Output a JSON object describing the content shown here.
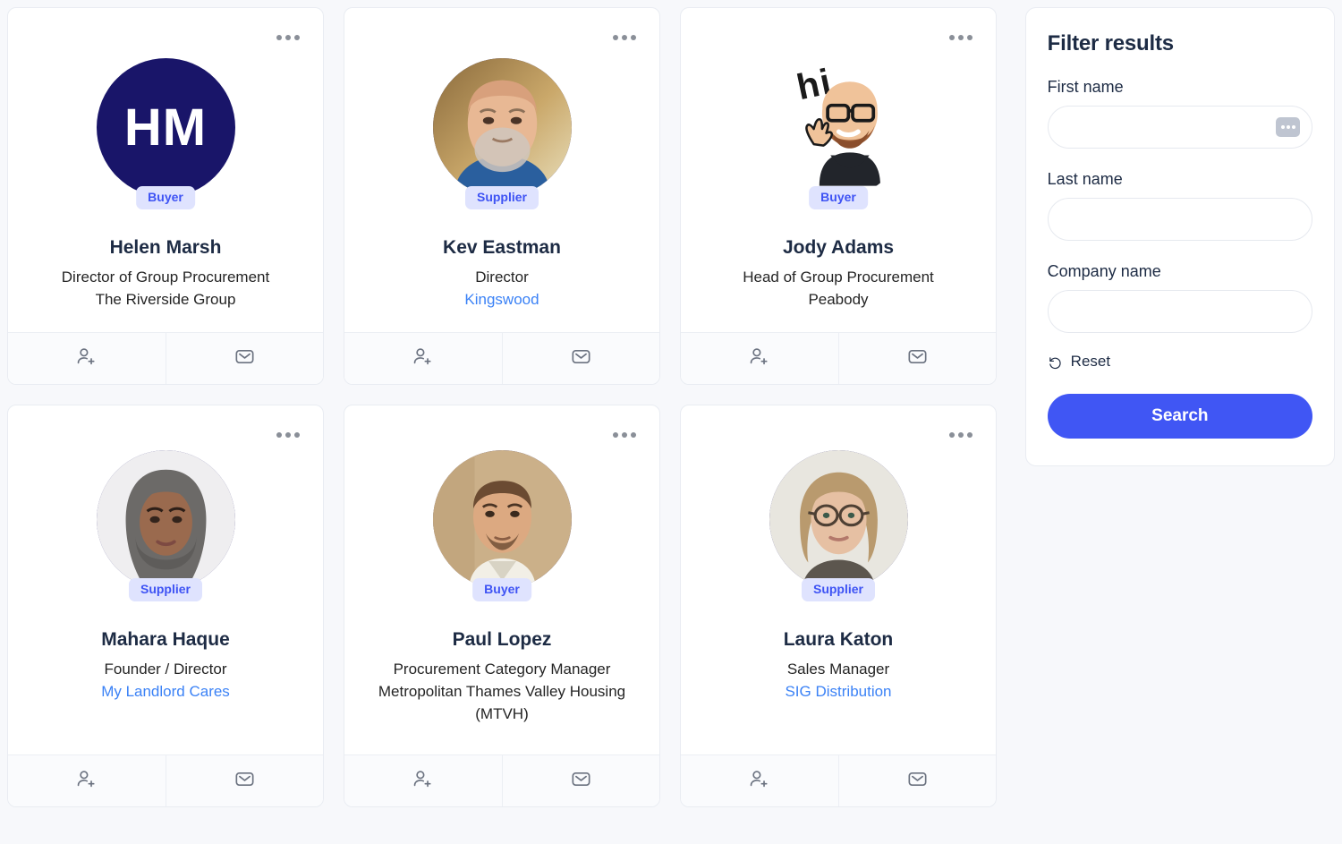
{
  "theme": {
    "page_background": "#f7f8fb",
    "card_background": "#ffffff",
    "accent_blue": "#4056f4",
    "badge_background": "#dfe3fe",
    "badge_text": "#3e53f4",
    "link_blue": "#3b82f6",
    "heading_navy": "#1d2b44",
    "avatar_initials_background": "#191569"
  },
  "results": {
    "cards": [
      {
        "name": "Helen Marsh",
        "role": "Director of Group Procurement",
        "company": "The Riverside Group",
        "company_is_link": false,
        "badge": "Buyer",
        "avatar_type": "initials",
        "initials": "HM",
        "menu_icon": "ellipsis-icon",
        "actions": [
          {
            "icon": "add-person-icon"
          },
          {
            "icon": "mail-icon"
          }
        ]
      },
      {
        "name": "Kev Eastman",
        "role": "Director",
        "company": "Kingswood",
        "company_is_link": true,
        "badge": "Supplier",
        "avatar_type": "photo-man-bald-beard",
        "initials": "",
        "menu_icon": "ellipsis-icon",
        "actions": [
          {
            "icon": "add-person-icon"
          },
          {
            "icon": "mail-icon"
          }
        ]
      },
      {
        "name": "Jody Adams",
        "role": "Head of Group Procurement",
        "company": "Peabody",
        "company_is_link": false,
        "badge": "Buyer",
        "avatar_type": "bitmoji-hi-wave",
        "initials": "",
        "avatar_caption": "hi",
        "menu_icon": "ellipsis-icon",
        "actions": [
          {
            "icon": "add-person-icon"
          },
          {
            "icon": "mail-icon"
          }
        ]
      },
      {
        "name": "Mahara Haque",
        "role": "Founder / Director",
        "company": "My Landlord Cares",
        "company_is_link": true,
        "badge": "Supplier",
        "avatar_type": "photo-woman-hijab",
        "initials": "",
        "menu_icon": "ellipsis-icon",
        "actions": [
          {
            "icon": "add-person-icon"
          },
          {
            "icon": "mail-icon"
          }
        ]
      },
      {
        "name": "Paul Lopez",
        "role": "Procurement Category Manager",
        "company": "Metropolitan Thames Valley Housing (MTVH)",
        "company_is_link": false,
        "badge": "Buyer",
        "avatar_type": "photo-man-short-hair",
        "initials": "",
        "menu_icon": "ellipsis-icon",
        "actions": [
          {
            "icon": "add-person-icon"
          },
          {
            "icon": "mail-icon"
          }
        ]
      },
      {
        "name": "Laura Katon",
        "role": "Sales Manager",
        "company": "SIG Distribution",
        "company_is_link": true,
        "badge": "Supplier",
        "avatar_type": "photo-woman-glasses",
        "initials": "",
        "menu_icon": "ellipsis-icon",
        "actions": [
          {
            "icon": "add-person-icon"
          },
          {
            "icon": "mail-icon"
          }
        ]
      }
    ]
  },
  "filter": {
    "title": "Filter results",
    "fields": [
      {
        "label": "First name",
        "value": "",
        "placeholder": "",
        "affordance_icon": "ellipsis-box-icon"
      },
      {
        "label": "Last name",
        "value": "",
        "placeholder": ""
      },
      {
        "label": "Company name",
        "value": "",
        "placeholder": ""
      }
    ],
    "reset_label": "Reset",
    "reset_icon": "rotate-ccw-icon",
    "search_label": "Search"
  }
}
